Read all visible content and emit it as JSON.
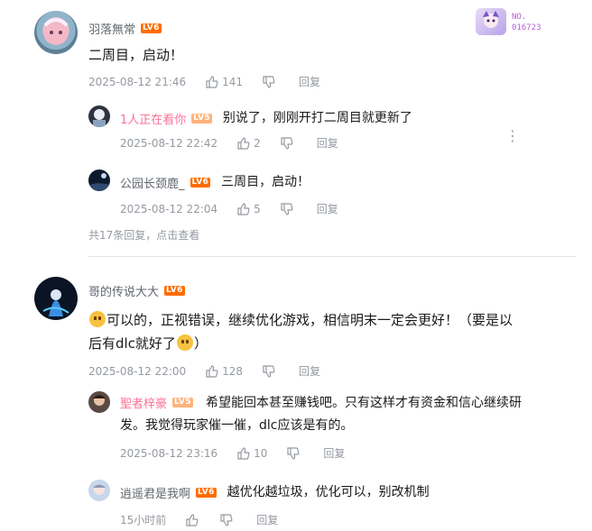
{
  "badge": {
    "label": "NO.",
    "number": "016723"
  },
  "comments": [
    {
      "user": "羽落無常",
      "level": "LV6",
      "text": "二周目，启动！",
      "time": "2025-08-12 21:46",
      "likes": "141",
      "reply_label": "回复",
      "replies": [
        {
          "user": "1人正在看你",
          "level": "LV5",
          "text": "别说了，刚刚开打二周目就更新了",
          "time": "2025-08-12 22:42",
          "likes": "2",
          "reply_label": "回复"
        },
        {
          "user": "公园长颈鹿_",
          "level": "LV6",
          "text": "三周目，启动！",
          "time": "2025-08-12 22:04",
          "likes": "5",
          "reply_label": "回复"
        }
      ],
      "more_replies": "共17条回复，点击查看"
    },
    {
      "user": "哥的传说大大",
      "level": "LV6",
      "text_line1": "可以的，正视错误，继续优化游戏，相信明末一定会更好！（要是以",
      "text_line2": "后有dlc就好了",
      "text_line2_end": "）",
      "time": "2025-08-12 22:00",
      "likes": "128",
      "reply_label": "回复",
      "replies": [
        {
          "user": "聖者梓豪",
          "level": "LV5",
          "text_line1": "希望能回本甚至赚钱吧。只有这样才有资金和信心继续研",
          "text_line2": "发。我觉得玩家催一催，dlc应该是有的。",
          "time": "2025-08-12 23:16",
          "likes": "10",
          "reply_label": "回复"
        },
        {
          "user": "逍遥君是我啊",
          "level": "LV6",
          "text": "越优化越垃圾，优化可以，别改机制",
          "time": "15小时前",
          "likes": "",
          "reply_label": "回复"
        }
      ]
    }
  ]
}
